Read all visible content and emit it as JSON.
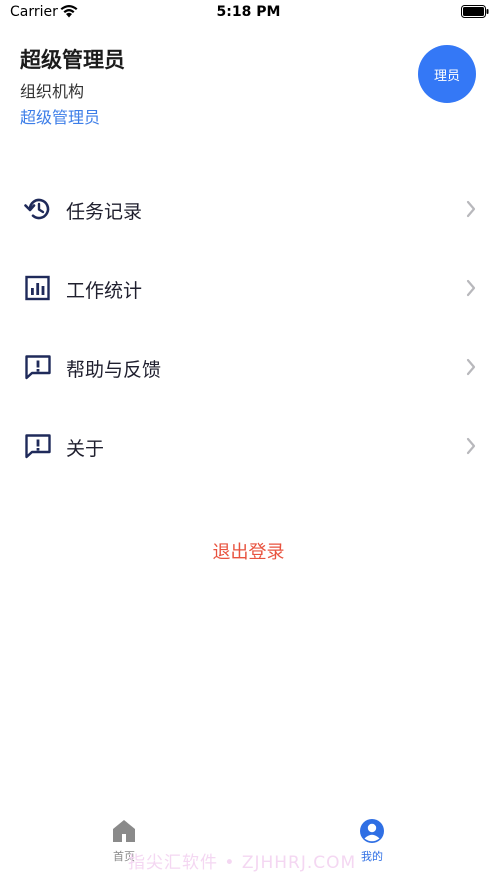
{
  "status_bar": {
    "carrier": "Carrier",
    "time": "5:18 PM"
  },
  "profile": {
    "name": "超级管理员",
    "org": "组织机构",
    "role": "超级管理员",
    "avatar_text": "理员"
  },
  "menu": {
    "items": [
      {
        "label": "任务记录",
        "icon": "history-icon"
      },
      {
        "label": "工作统计",
        "icon": "bar-chart-icon"
      },
      {
        "label": "帮助与反馈",
        "icon": "feedback-icon"
      },
      {
        "label": "关于",
        "icon": "info-message-icon"
      }
    ]
  },
  "logout_label": "退出登录",
  "tab_bar": {
    "home_label": "首页",
    "me_label": "我的"
  },
  "watermark": "指尖汇软件 • ZJHHRJ.COM",
  "colors": {
    "accent": "#3478f6",
    "logout": "#e8533f",
    "icon_dark": "#1f2a5a"
  }
}
